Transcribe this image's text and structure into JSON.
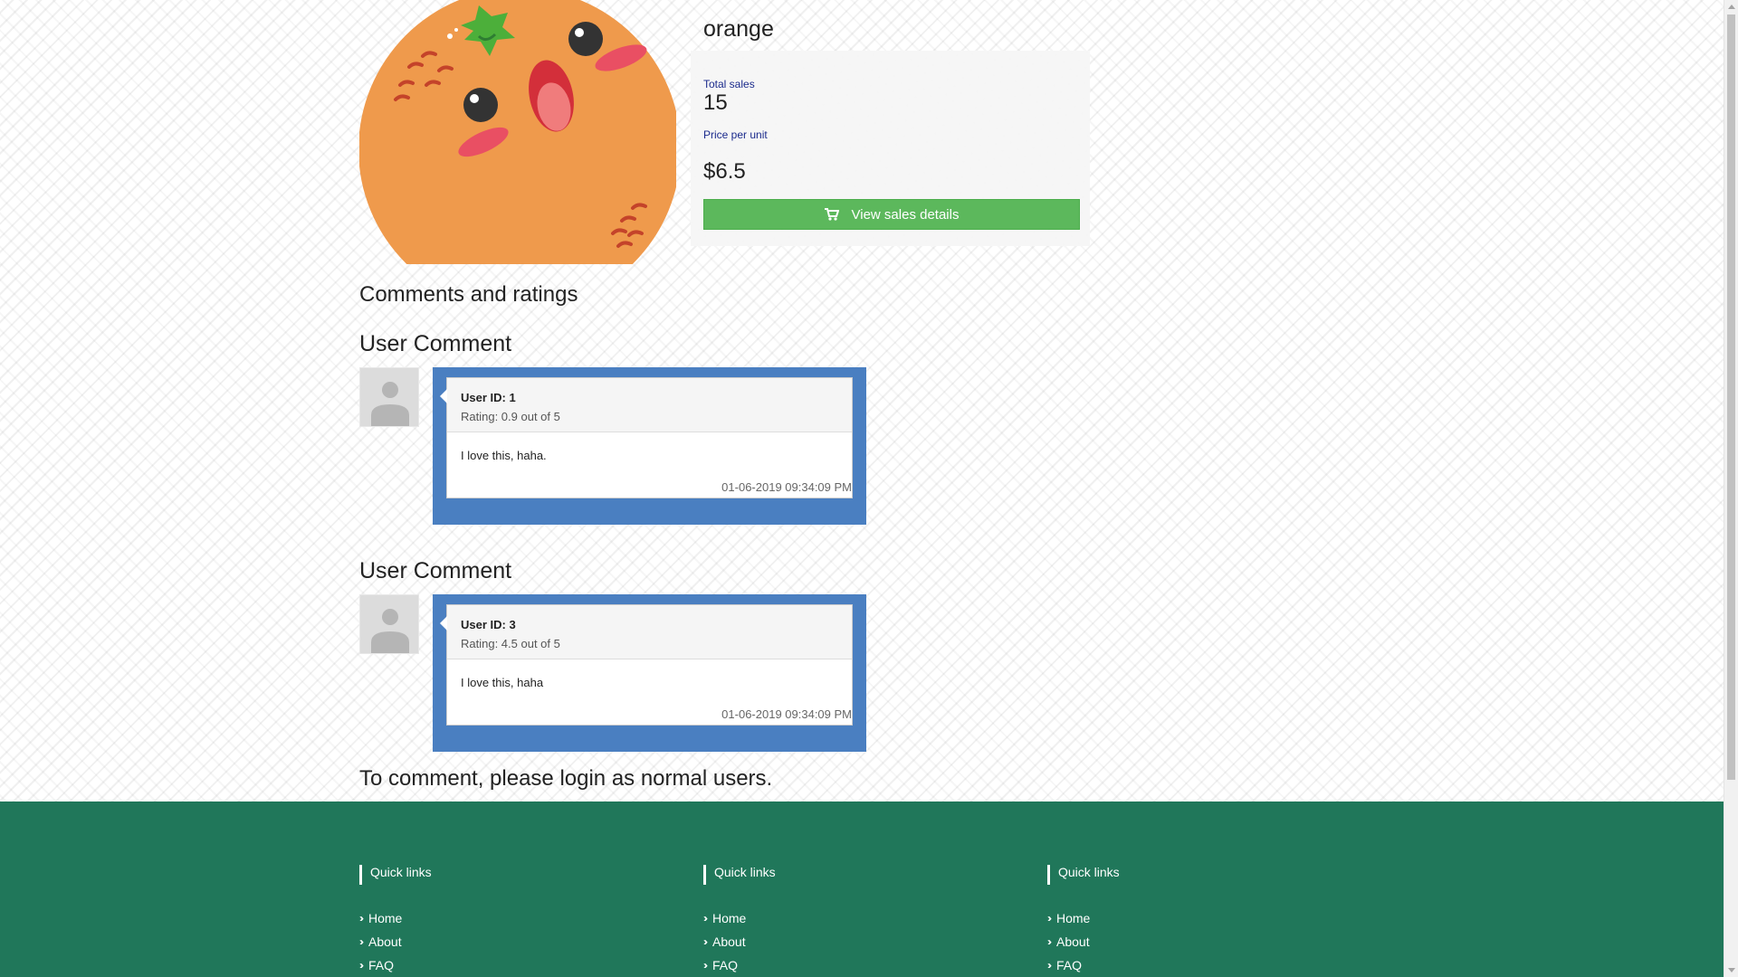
{
  "product": {
    "name": "orange",
    "image_alt": "orange-character-illustration",
    "total_sales_label": "Total sales",
    "total_sales_value": "15",
    "price_label": "Price per unit",
    "price_value": "$6.5",
    "view_sales_label": "View sales details"
  },
  "comments_section": {
    "heading": "Comments and ratings",
    "comments": [
      {
        "heading": "User Comment",
        "user_id": "User ID: 1",
        "rating": "Rating: 0.9 out of 5",
        "text": "I love this, haha.",
        "timestamp": "01-06-2019 09:34:09 PM"
      },
      {
        "heading": "User Comment",
        "user_id": "User ID: 3",
        "rating": "Rating: 4.5 out of 5",
        "text": "I love this, haha",
        "timestamp": "01-06-2019 09:34:09 PM"
      }
    ],
    "login_note": "To comment, please login as normal users."
  },
  "footer": {
    "columns": [
      {
        "title": "Quick links",
        "links": [
          "Home",
          "About",
          "FAQ"
        ]
      },
      {
        "title": "Quick links",
        "links": [
          "Home",
          "About",
          "FAQ"
        ]
      },
      {
        "title": "Quick links",
        "links": [
          "Home",
          "About",
          "FAQ"
        ]
      }
    ]
  },
  "colors": {
    "orange": "#ef9a4c",
    "button_green": "#5cb85c",
    "comment_blue": "#4a7fc1",
    "footer_green": "#20775a",
    "label_navy": "#1a2a8c"
  },
  "icons": {
    "cart": "shopping-cart-icon",
    "avatar": "user-placeholder-icon",
    "link_bullet": "double-chevron-right-icon"
  }
}
